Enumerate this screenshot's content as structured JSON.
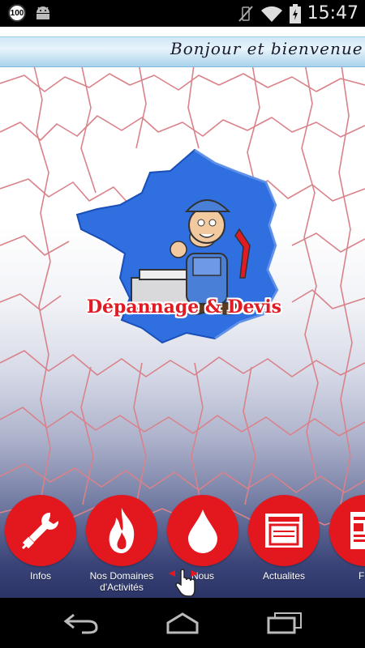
{
  "status_bar": {
    "time": "15:47",
    "notification_badge": "100",
    "icons": [
      "android-icon",
      "mute-icon",
      "wifi-icon",
      "battery-icon"
    ]
  },
  "banner": {
    "text": "Bonjour et bienvenue s"
  },
  "logo": {
    "title": "Dépannage & Devis"
  },
  "menu": [
    {
      "label": "Infos",
      "icon": "wrench-plug-icon"
    },
    {
      "label": "Nos Domaines d'Activités",
      "icon": "flame-icon"
    },
    {
      "label": "Nous",
      "icon": "water-drop-icon"
    },
    {
      "label": "Actualites",
      "icon": "oven-icon"
    },
    {
      "label": "Fly",
      "icon": "flyer-icon"
    }
  ],
  "colors": {
    "accent_red": "#e3181f",
    "map_lines": "#d9828a",
    "logo_blue": "#2f6fe0"
  },
  "nav_bar": [
    "back-icon",
    "home-icon",
    "recent-apps-icon"
  ]
}
